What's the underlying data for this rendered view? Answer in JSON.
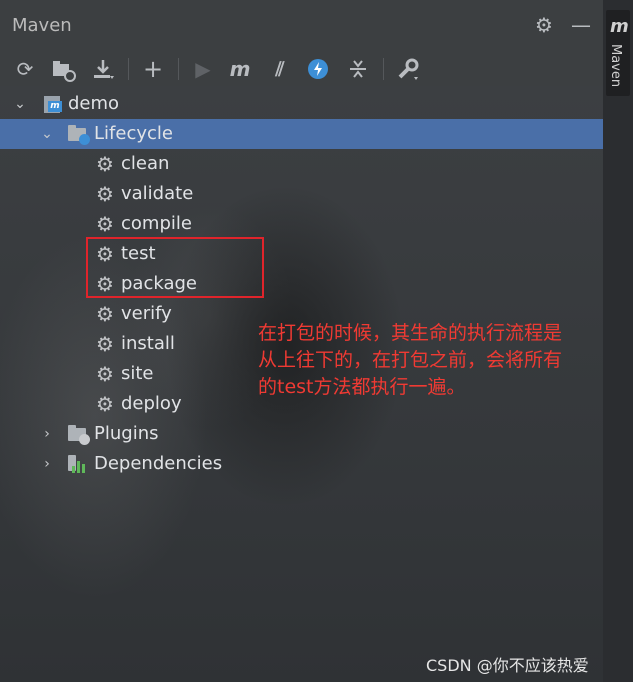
{
  "panel": {
    "title": "Maven"
  },
  "side_tab": {
    "label": "Maven",
    "icon_letter": "m"
  },
  "tree": {
    "root": {
      "label": "demo"
    },
    "lifecycle": {
      "label": "Lifecycle"
    },
    "phases": [
      "clean",
      "validate",
      "compile",
      "test",
      "package",
      "verify",
      "install",
      "site",
      "deploy"
    ],
    "plugins": {
      "label": "Plugins"
    },
    "dependencies": {
      "label": "Dependencies"
    }
  },
  "annotation": {
    "line1": "在打包的时候，其生命的执行流程是",
    "line2": "从上往下的，在打包之前，会将所有",
    "line3": "的test方法都执行一遍。"
  },
  "watermark": "CSDN @你不应该热爱",
  "colors": {
    "selection": "#4a6fa8",
    "annotation_red": "#f03a33",
    "box_red": "#e0242b",
    "maven_blue": "#3d8fd6"
  }
}
